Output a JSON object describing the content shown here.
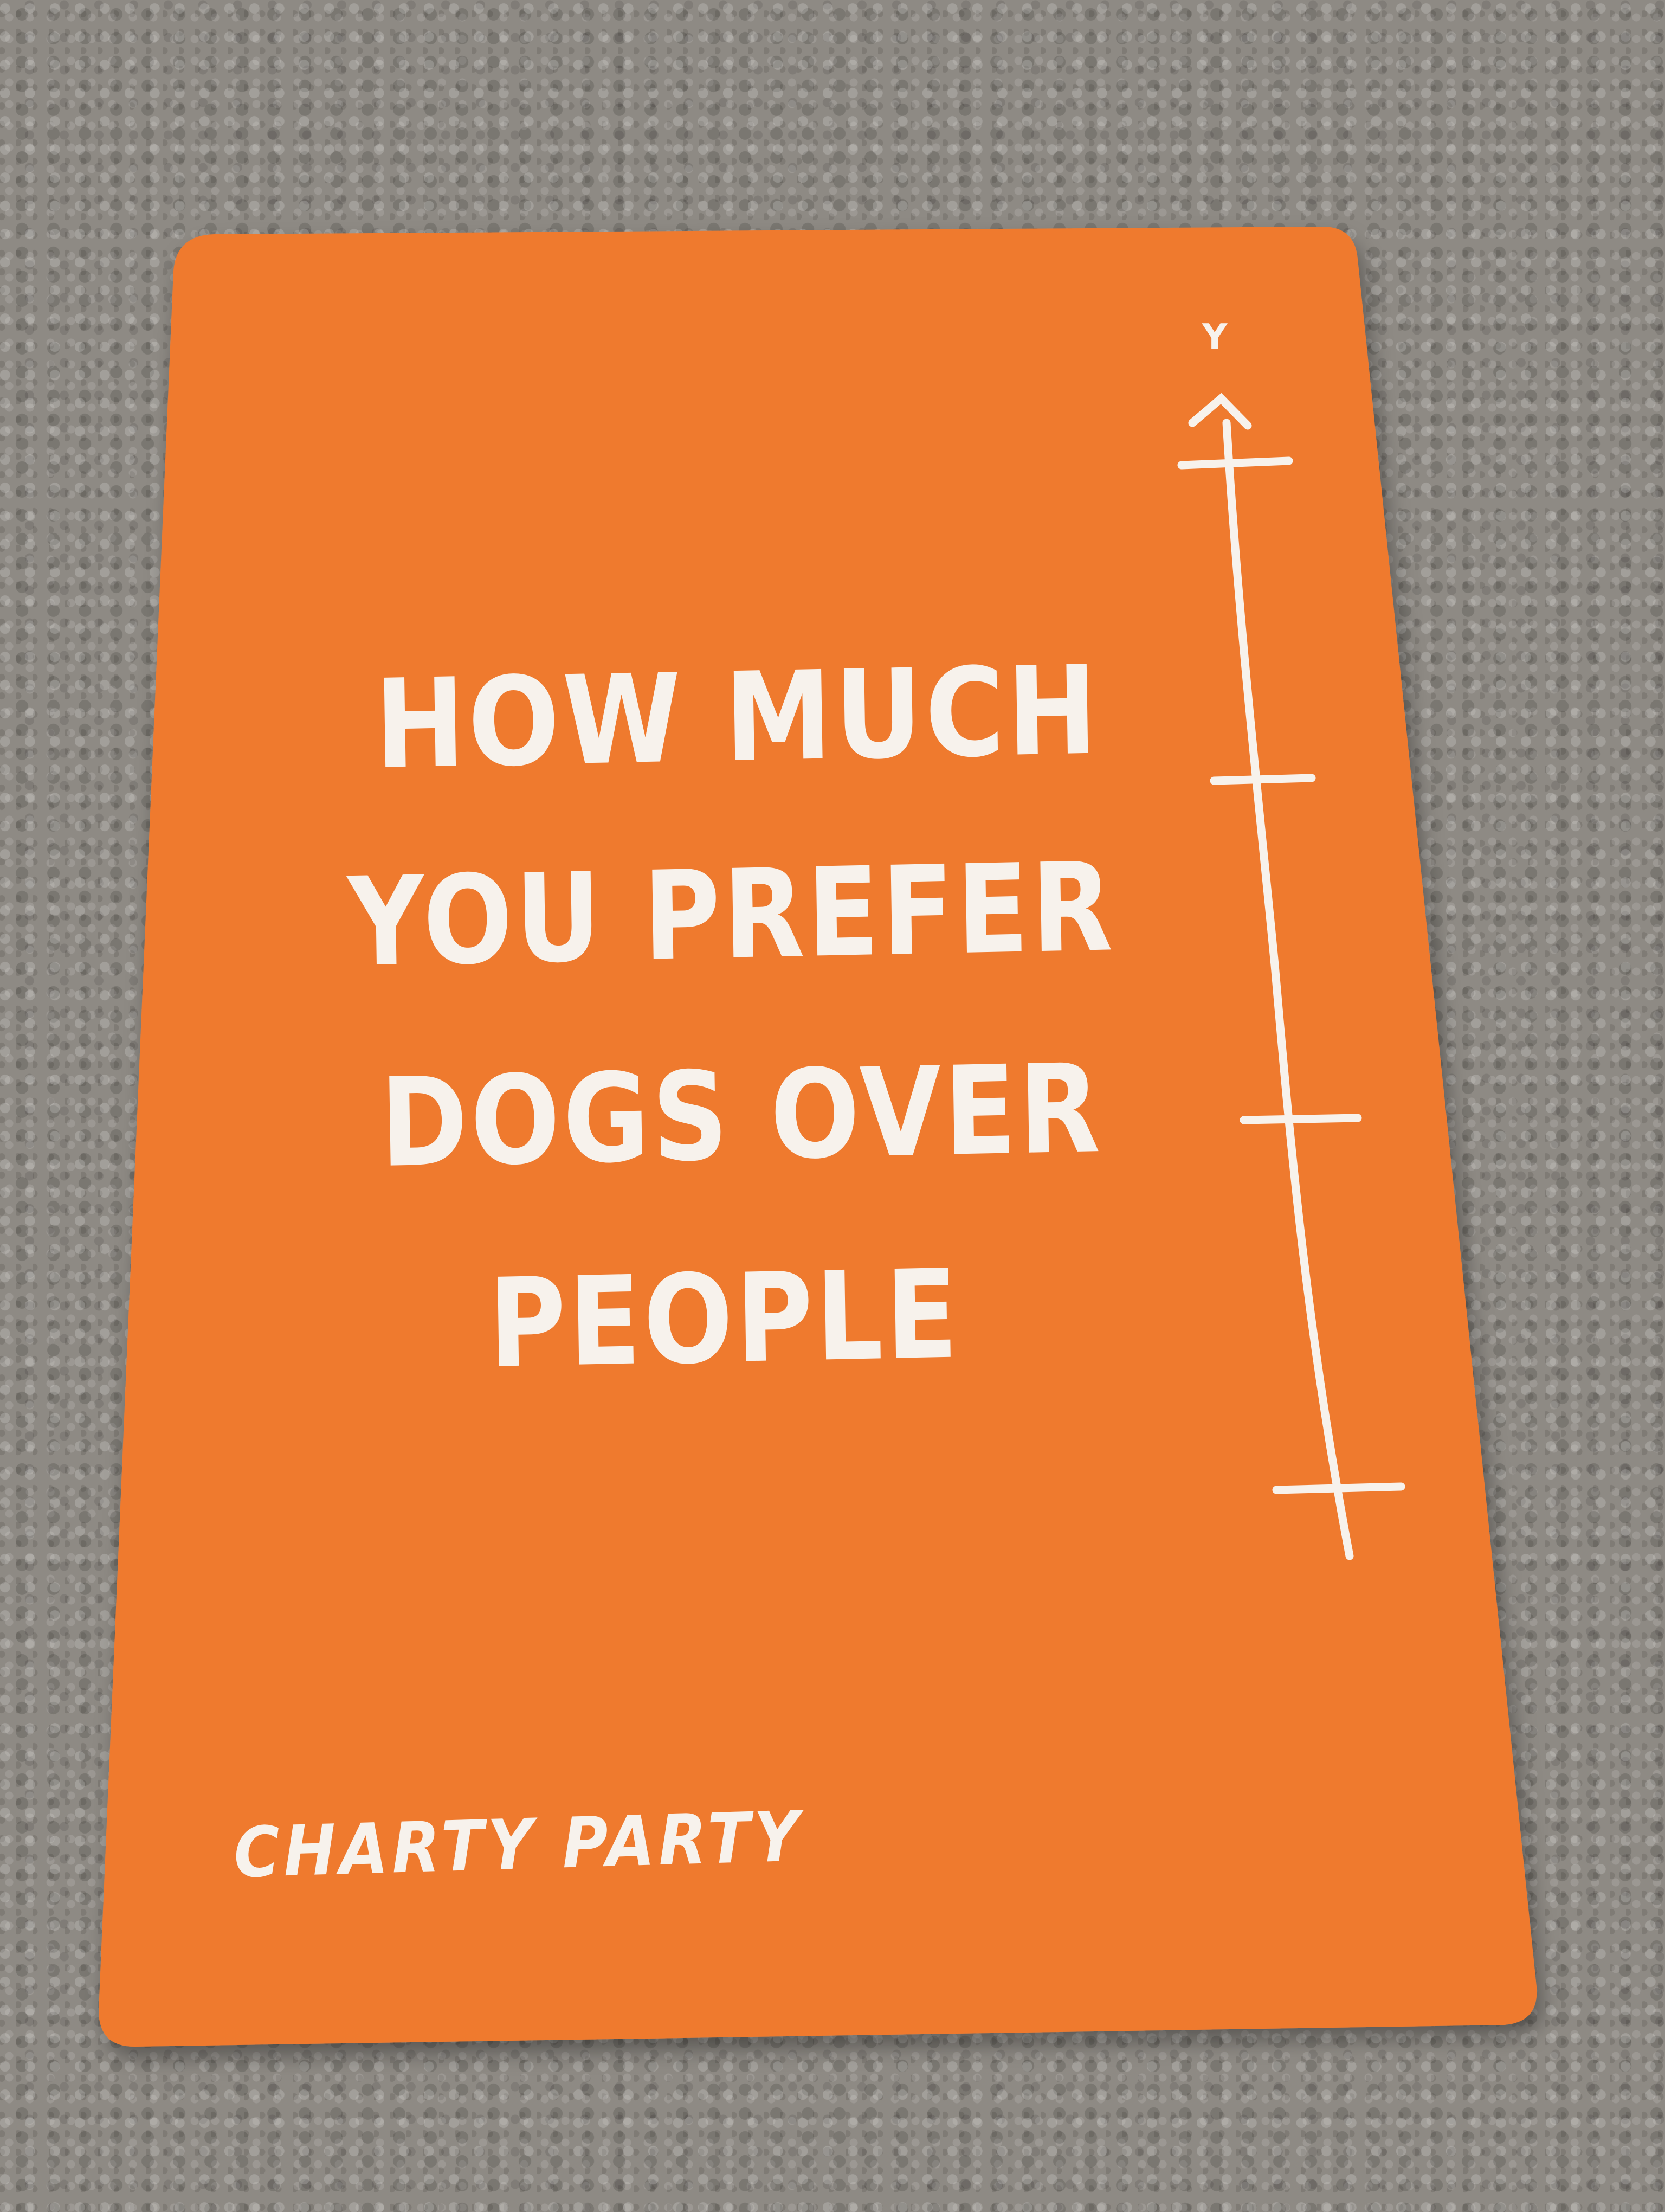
{
  "card": {
    "title_lines": [
      "HOW MUCH",
      "YOU PREFER",
      "DOGS OVER",
      "PEOPLE"
    ],
    "brand": "CHARTY PARTY",
    "axis_label": "Y",
    "colors": {
      "card": "#ef7a2f",
      "ink": "#f7f2ec",
      "carpet": "#8e8a84"
    }
  }
}
